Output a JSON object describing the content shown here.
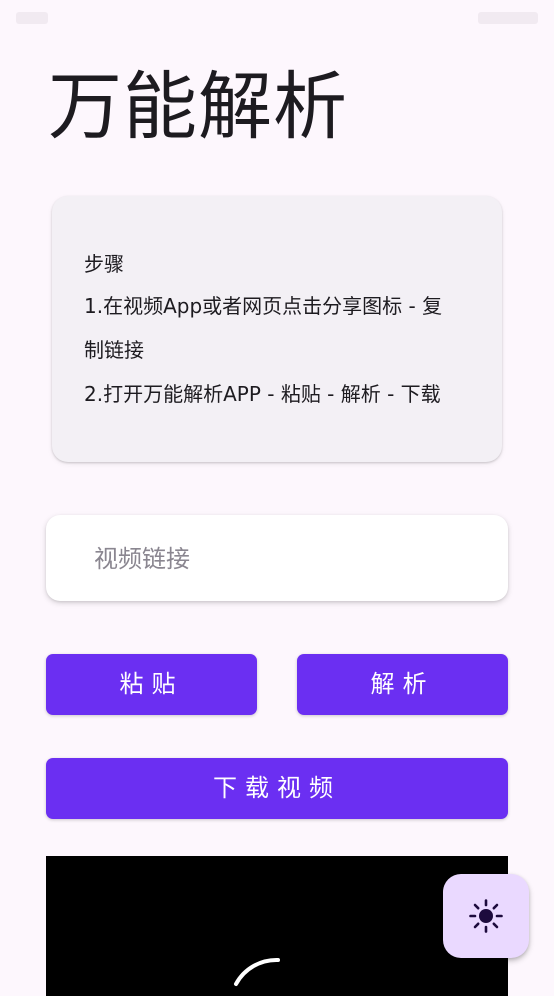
{
  "app": {
    "title": "万能解析"
  },
  "steps": {
    "heading": "步骤",
    "step1_line1": "1.在视频App或者网页点击分享图标 - 复",
    "step1_line2": "制链接",
    "step2": "2.打开万能解析APP - 粘贴 - 解析 - 下载"
  },
  "link_input": {
    "placeholder": "视频链接",
    "value": ""
  },
  "buttons": {
    "paste_label": "粘贴",
    "parse_label": "解析",
    "download_label": "下载视频"
  },
  "fab": {
    "icon": "sun-icon"
  },
  "colors": {
    "primary": "#6b2ff2",
    "background": "#fdf7fd",
    "card": "#f3f0f5",
    "fab": "#ead9ff",
    "fab_icon": "#1d0b3d"
  }
}
